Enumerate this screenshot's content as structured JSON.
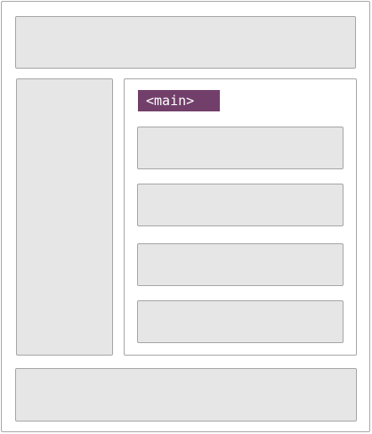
{
  "diagram": {
    "main_label": "<main>",
    "colors": {
      "block_fill": "#e6e6e6",
      "block_border": "#a6a6a6",
      "label_fill": "#723f6b",
      "label_text": "#ffffff"
    }
  }
}
